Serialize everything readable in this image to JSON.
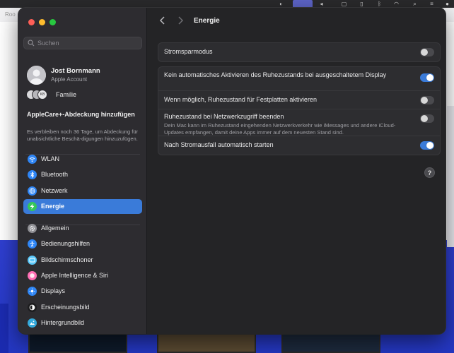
{
  "background": {
    "tab_text": "Roo"
  },
  "window": {
    "search": {
      "placeholder": "Suchen"
    },
    "account": {
      "name": "Jost Bornmann",
      "subtitle": "Apple Account"
    },
    "family": {
      "label": "Familie",
      "avatar_initials": "KB"
    },
    "applecare": {
      "title": "AppleCare+-Abdeckung hinzufügen",
      "body": "Es verbleiben noch 36 Tage, um Abdeckung für unabsichtliche Beschä-digungen hinzuzufügen."
    },
    "sidebar_group1": [
      {
        "label": "WLAN",
        "icon": "wifi-icon",
        "color": "#2f86f6",
        "active": false
      },
      {
        "label": "Bluetooth",
        "icon": "bluetooth-icon",
        "color": "#2f86f6",
        "active": false
      },
      {
        "label": "Netzwerk",
        "icon": "globe-icon",
        "color": "#2f86f6",
        "active": false
      },
      {
        "label": "Energie",
        "icon": "bolt-icon",
        "color": "#34c759",
        "active": true
      }
    ],
    "sidebar_group2": [
      {
        "label": "Allgemein",
        "icon": "gear-icon",
        "color": "#8e8e93"
      },
      {
        "label": "Bedienungshilfen",
        "icon": "accessibility-icon",
        "color": "#2f86f6"
      },
      {
        "label": "Bildschirmschoner",
        "icon": "screensaver-icon",
        "color": "#5ac8fa"
      },
      {
        "label": "Apple Intelligence & Siri",
        "icon": "siri-icon",
        "color": "#ff6fb5"
      },
      {
        "label": "Displays",
        "icon": "sun-icon",
        "color": "#2f86f6"
      },
      {
        "label": "Erscheinungsbild",
        "icon": "appearance-icon",
        "color": "#1c1c1e"
      },
      {
        "label": "Hintergrundbild",
        "icon": "wallpaper-icon",
        "color": "#34aadc"
      }
    ],
    "main": {
      "title": "Energie",
      "group1": [
        {
          "label": "Stromsparmodus",
          "on": false
        }
      ],
      "group2": [
        {
          "label": "Kein automatisches Aktivieren des Ruhezustands bei ausgeschaltetem Display",
          "on": true
        },
        {
          "label": "Wenn möglich, Ruhezustand für Festplatten aktivieren",
          "on": false
        },
        {
          "label": "Ruhezustand bei Netzwerkzugriff beenden",
          "description": "Dein Mac kann im Ruhezustand eingehenden Netzwerkverkehr wie iMessages und andere iCloud-Updates empfangen, damit deine Apps immer auf dem neuesten Stand sind.",
          "on": false
        },
        {
          "label": "Nach Stromausfall automatisch starten",
          "on": true
        }
      ],
      "help_label": "?"
    },
    "accent_color": "#3a7bd9"
  }
}
